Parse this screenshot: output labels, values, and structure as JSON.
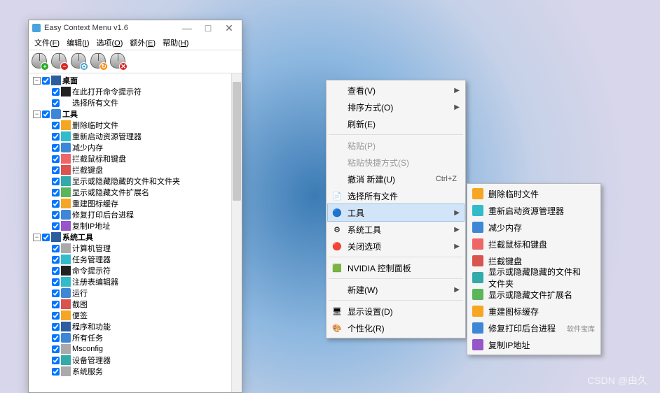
{
  "watermark": "CSDN @由久",
  "window": {
    "title": "Easy Context Menu v1.6",
    "controls": {
      "min": "—",
      "max": "□",
      "close": "✕"
    },
    "menus": [
      {
        "label": "文件",
        "accel": "F"
      },
      {
        "label": "编辑",
        "accel": "I"
      },
      {
        "label": "选项",
        "accel": "O"
      },
      {
        "label": "额外",
        "accel": "E"
      },
      {
        "label": "帮助",
        "accel": "H"
      }
    ]
  },
  "tree": [
    {
      "type": "group",
      "label": "桌面",
      "iconBg": "i-navy",
      "children": [
        {
          "label": "在此打开命令提示符",
          "iconBg": "i-black"
        },
        {
          "label": "选择所有文件",
          "iconBg": ""
        }
      ]
    },
    {
      "type": "group",
      "label": "工具",
      "iconBg": "i-blue",
      "children": [
        {
          "label": "删除临时文件",
          "iconBg": "i-orange"
        },
        {
          "label": "重新启动资源管理器",
          "iconBg": "i-cyan"
        },
        {
          "label": "减少内存",
          "iconBg": "i-blue"
        },
        {
          "label": "拦截鼠标和键盘",
          "iconBg": "i-pink"
        },
        {
          "label": "拦截键盘",
          "iconBg": "i-red"
        },
        {
          "label": "显示或隐藏隐藏的文件和文件夹",
          "iconBg": "i-teal"
        },
        {
          "label": "显示或隐藏文件扩展名",
          "iconBg": "i-green"
        },
        {
          "label": "重建图标缓存",
          "iconBg": "i-orange"
        },
        {
          "label": "修复打印后台进程",
          "iconBg": "i-blue"
        },
        {
          "label": "复制IP地址",
          "iconBg": "i-purple"
        }
      ]
    },
    {
      "type": "group",
      "label": "系统工具",
      "iconBg": "i-navy",
      "children": [
        {
          "label": "计算机管理",
          "iconBg": "i-gray"
        },
        {
          "label": "任务管理器",
          "iconBg": "i-cyan"
        },
        {
          "label": "命令提示符",
          "iconBg": "i-black"
        },
        {
          "label": "注册表编辑器",
          "iconBg": "i-cyan"
        },
        {
          "label": "运行",
          "iconBg": "i-blue"
        },
        {
          "label": "截图",
          "iconBg": "i-red"
        },
        {
          "label": "便签",
          "iconBg": "i-orange"
        },
        {
          "label": "程序和功能",
          "iconBg": "i-navy"
        },
        {
          "label": "所有任务",
          "iconBg": "i-blue"
        },
        {
          "label": "Msconfig",
          "iconBg": "i-gray"
        },
        {
          "label": "设备管理器",
          "iconBg": "i-teal"
        },
        {
          "label": "系统服务",
          "iconBg": "i-gray"
        }
      ]
    }
  ],
  "contextMenu1": [
    {
      "label": "查看(V)",
      "sub": true
    },
    {
      "label": "排序方式(O)",
      "sub": true
    },
    {
      "label": "刷新(E)"
    },
    {
      "sep": true
    },
    {
      "label": "粘贴(P)",
      "disabled": true
    },
    {
      "label": "粘贴快捷方式(S)",
      "disabled": true
    },
    {
      "label": "撤消 新建(U)",
      "shortcut": "Ctrl+Z"
    },
    {
      "label": "选择所有文件",
      "icon": "📄"
    },
    {
      "label": "工具",
      "sub": true,
      "hl": true,
      "icon": "🔵"
    },
    {
      "label": "系统工具",
      "sub": true,
      "icon": "⚙"
    },
    {
      "label": "关闭选项",
      "sub": true,
      "icon": "🔴"
    },
    {
      "sep": true
    },
    {
      "label": "NVIDIA 控制面板",
      "icon": "🟩"
    },
    {
      "sep": true
    },
    {
      "label": "新建(W)",
      "sub": true
    },
    {
      "sep": true
    },
    {
      "label": "显示设置(D)",
      "icon": "🖥"
    },
    {
      "label": "个性化(R)",
      "icon": "🎨"
    }
  ],
  "contextMenu2": [
    {
      "label": "删除临时文件",
      "iconBg": "i-orange"
    },
    {
      "label": "重新启动资源管理器",
      "iconBg": "i-cyan"
    },
    {
      "label": "减少内存",
      "iconBg": "i-blue"
    },
    {
      "label": "拦截鼠标和键盘",
      "iconBg": "i-pink"
    },
    {
      "label": "拦截键盘",
      "iconBg": "i-red"
    },
    {
      "label": "显示或隐藏隐藏的文件和文件夹",
      "iconBg": "i-teal"
    },
    {
      "label": "显示或隐藏文件扩展名",
      "iconBg": "i-green"
    },
    {
      "label": "重建图标缓存",
      "iconBg": "i-orange"
    },
    {
      "label": "修复打印后台进程",
      "iconBg": "i-blue",
      "wm": "软件宝库"
    },
    {
      "label": "复制IP地址",
      "iconBg": "i-purple"
    }
  ]
}
